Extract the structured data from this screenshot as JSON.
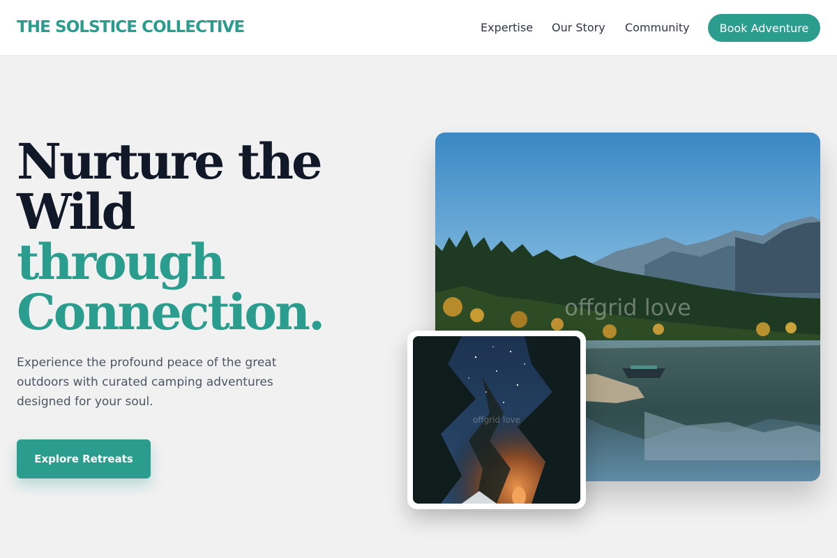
{
  "brand": {
    "name": "THE SOLSTICE COLLECTIVE"
  },
  "nav": {
    "links": [
      {
        "label": "Expertise"
      },
      {
        "label": "Our Story"
      },
      {
        "label": "Community"
      }
    ],
    "cta_label": "Book Adventure"
  },
  "hero": {
    "headline_line1": "Nurture the",
    "headline_line2": "Wild",
    "headline_line3": "through",
    "headline_line4": "Connection.",
    "lead": "Experience the profound peace of the great outdoors with curated camping adventures designed for your soul.",
    "cta_label": "Explore Retreats"
  },
  "images": {
    "main_watermark": "offgrid love",
    "small_watermark": "offgrid love"
  },
  "colors": {
    "accent": "#2a9d8f",
    "headline": "#111827",
    "background": "#f1f1f1"
  }
}
